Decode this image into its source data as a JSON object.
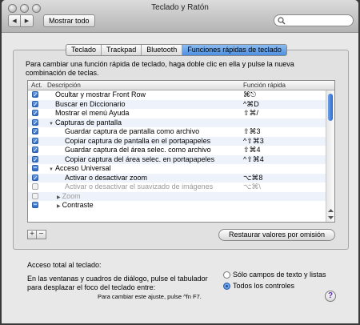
{
  "window": {
    "title": "Teclado y Ratón"
  },
  "toolbar": {
    "back": "◀",
    "forward": "▶",
    "show_all": "Mostrar todo",
    "search_value": ""
  },
  "tabs": [
    {
      "label": "Teclado"
    },
    {
      "label": "Trackpad"
    },
    {
      "label": "Bluetooth"
    },
    {
      "label": "Funciones rápidas de teclado",
      "active": true
    }
  ],
  "instructions": {
    "line1": "Para cambiar una función rápida de teclado, haga doble clic en ella y pulse la nueva",
    "line2": "combinación de teclas."
  },
  "table": {
    "headers": {
      "act": "Act.",
      "desc": "Descripción",
      "shortcut": "Función rápida"
    },
    "rows": [
      {
        "desc": "Ocultar y mostrar Front Row",
        "shortcut": "⌘⎋"
      },
      {
        "desc": "Buscar en Diccionario",
        "shortcut": "^⌘D"
      },
      {
        "desc": "Mostrar el menú Ayuda",
        "shortcut": "⇧⌘/"
      },
      {
        "desc": "Capturas de pantalla",
        "shortcut": ""
      },
      {
        "desc": "Guardar captura de pantalla como archivo",
        "shortcut": "⇧⌘3"
      },
      {
        "desc": "Copiar captura de pantalla en el portapapeles",
        "shortcut": "^⇧⌘3"
      },
      {
        "desc": "Guardar captura del área selec. como archivo",
        "shortcut": "⇧⌘4"
      },
      {
        "desc": "Copiar captura del área selec. en portapapeles",
        "shortcut": "^⇧⌘4"
      },
      {
        "desc": "Acceso Universal",
        "shortcut": ""
      },
      {
        "desc": "Activar o desactivar zoom",
        "shortcut": "⌥⌘8"
      },
      {
        "desc": "Activar o desactivar el suavizado de imágenes",
        "shortcut": "⌥⌘\\"
      },
      {
        "desc": "Zoom",
        "shortcut": ""
      },
      {
        "desc": "Contraste",
        "shortcut": ""
      }
    ]
  },
  "buttons": {
    "add": "+",
    "remove": "−",
    "restore": "Restaurar valores por omisión"
  },
  "access": {
    "title": "Acceso total al teclado:",
    "desc1": "En las ventanas y cuadros de diálogo, pulse el tabulador",
    "desc2": "para desplazar el foco del teclado entre:",
    "option1": "Sólo campos de texto y listas",
    "option2": "Todos los controles",
    "hint": "Para cambiar este ajuste, pulse ^fn F7."
  },
  "help": {
    "label": "?"
  },
  "colors": {
    "accent": "#3a78d4",
    "window_bg": "#e8e8e8"
  }
}
